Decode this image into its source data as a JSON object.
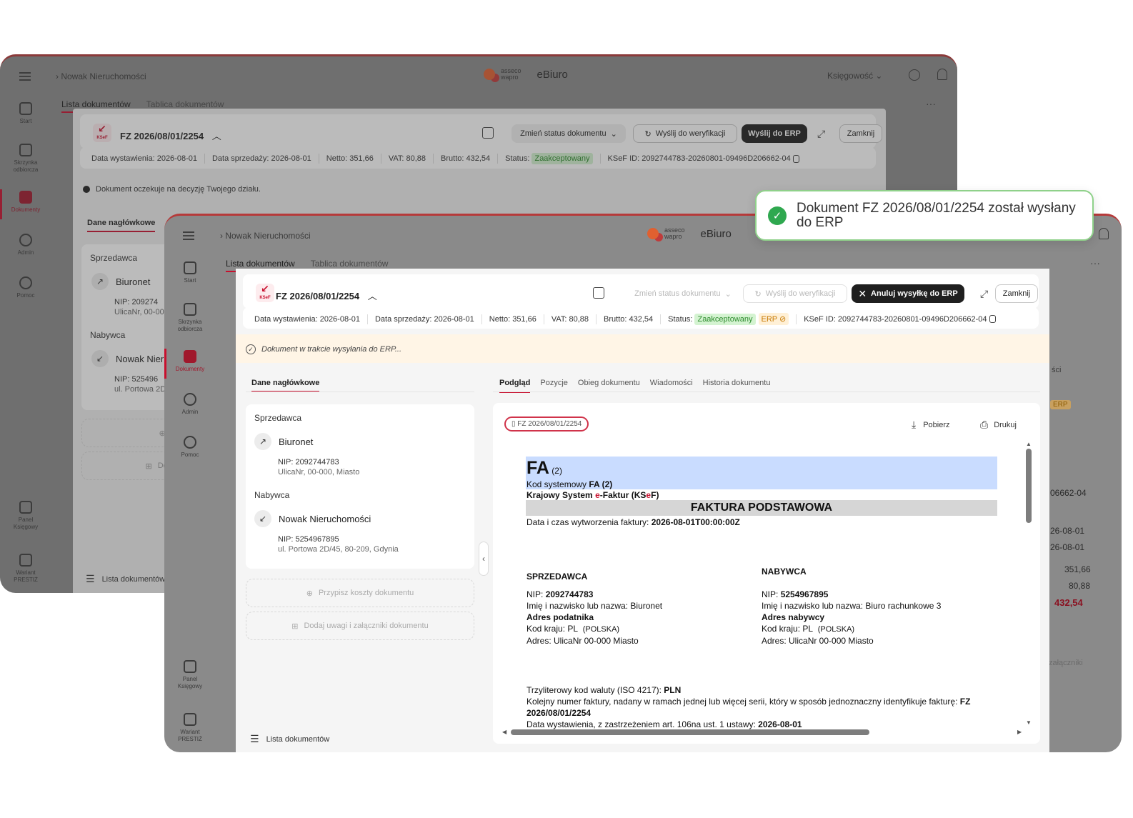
{
  "app": {
    "breadcrumb": "Nowak Nieruchomości",
    "logo_text_1": "asseco",
    "logo_text_2": "wapro",
    "app_name": "eBiuro",
    "role": "Księgowość",
    "more": "···"
  },
  "rail": {
    "start": "Start",
    "inbox_1": "Skrzynka",
    "inbox_2": "odbiorcza",
    "docs": "Dokumenty",
    "admin": "Admin",
    "help": "Pomoc",
    "panel_1": "Panel",
    "panel_2": "Księgowy",
    "variant_1": "Wariant",
    "variant_2": "PRESTIŻ"
  },
  "subtabs": {
    "list": "Lista dokumentów",
    "board": "Tablica dokumentów"
  },
  "doc": {
    "ksef_label": "KSeF",
    "number": "FZ 2026/08/01/2254",
    "change_status": "Zmień status dokumentu",
    "send_verify": "Wyślij do weryfikacji",
    "send_erp": "Wyślij do ERP",
    "cancel_erp": "Anuluj wysyłkę do ERP",
    "close": "Zamknij",
    "issue_date": "Data wystawienia: 2026-08-01",
    "sale_date": "Data sprzedaży: 2026-08-01",
    "net": "Netto: 351,66",
    "vat": "VAT: 80,88",
    "gross": "Brutto: 432,54",
    "status_label": "Status:",
    "status_value": "Zaakceptowany",
    "erp_badge": "ERP",
    "ksef_id": "KSeF ID: 2092744783-20260801-09496D206662-04",
    "notice_back": "Dokument oczekuje na decyzję Twojego działu.",
    "notice_front": "Dokument w trakcie wysyłania do ERP..."
  },
  "left_panel": {
    "title": "Dane nagłówkowe",
    "seller_label": "Sprzedawca",
    "seller_name": "Biuronet",
    "seller_nip": "NIP: 2092744783",
    "seller_addr": "UlicaNr, 00-000, Miasto",
    "buyer_label": "Nabywca",
    "buyer_name": "Nowak Nieruchomości",
    "buyer_nip": "NIP: 5254967895",
    "buyer_addr": "ul. Portowa 2D/45, 80-209, Gdynia",
    "assign_costs": "Przypisz koszty dokumentu",
    "add_notes": "Dodaj uwagi i załączniki dokumentu",
    "back_seller_name": "Biuronet",
    "back_seller_nip": "NIP: 209274",
    "back_seller_addr": "UlicaNr, 00-00",
    "back_buyer_name": "Nowak Nier",
    "back_buyer_nip": "NIP: 525496",
    "back_buyer_addr": "ul. Portowa 2D",
    "back_assign": "P",
    "back_add": "Doda",
    "list": "Lista dokumentów"
  },
  "right_tabs": [
    "Podgląd",
    "Pozycje",
    "Obieg dokumentu",
    "Wiadomości",
    "Historia dokumentu"
  ],
  "preview": {
    "chip": "FZ 2026/08/01/2254",
    "download": "Pobierz",
    "print": "Drukuj"
  },
  "invoice": {
    "fa": "FA",
    "fa_ver": "(2)",
    "sys_code_label": "Kod systemowy",
    "sys_code": "FA (2)",
    "ksef_line_1": "Krajowy System",
    "ksef_line_e": "e",
    "ksef_line_2": "-Faktur (KS",
    "ksef_line_e2": "e",
    "ksef_line_3": "F)",
    "heading": "FAKTURA PODSTAWOWA",
    "created_label": "Data i czas wytworzenia faktury:",
    "created": "2026-08-01T00:00:00Z",
    "seller_h": "SPRZEDAWCA",
    "buyer_h": "NABYWCA",
    "nip_label": "NIP:",
    "seller_nip": "2092744783",
    "buyer_nip": "5254967895",
    "seller_name": "Imię i nazwisko lub nazwa: Biuronet",
    "buyer_name": "Imię i nazwisko lub nazwa: Biuro rachunkowe 3",
    "seller_addr_h": "Adres podatnika",
    "buyer_addr_h": "Adres nabywcy",
    "country": "Kod kraju: PL",
    "country_2": "(POLSKA)",
    "address": "Adres: UlicaNr 00-000 Miasto",
    "currency_label": "Trzyliterowy kod waluty (ISO 4217):",
    "currency": "PLN",
    "seq_label": "Kolejny numer faktury, nadany w ramach jednej lub więcej serii, który w sposób jednoznaczny identyfikuje fakturę:",
    "seq": "FZ 2026/08/01/2254",
    "issue_label": "Data wystawienia, z zastrzeżeniem art. 106na ust. 1 ustawy:",
    "issue": "2026-08-01"
  },
  "toast": {
    "text": "Dokument FZ 2026/08/01/2254 został wysłany do ERP"
  },
  "peek": {
    "sci": "ści",
    "id_tail": "06662-04",
    "date1": "26-08-01",
    "date2": "26-08-01",
    "v1": "351,66",
    "v2": "80,88",
    "v3": "432,54",
    "att": "załączniki"
  },
  "colors": {
    "accent": "#c8102e",
    "success": "#2fa84f",
    "notice_bg": "#fff5e6",
    "highlight": "#c9dcff"
  }
}
